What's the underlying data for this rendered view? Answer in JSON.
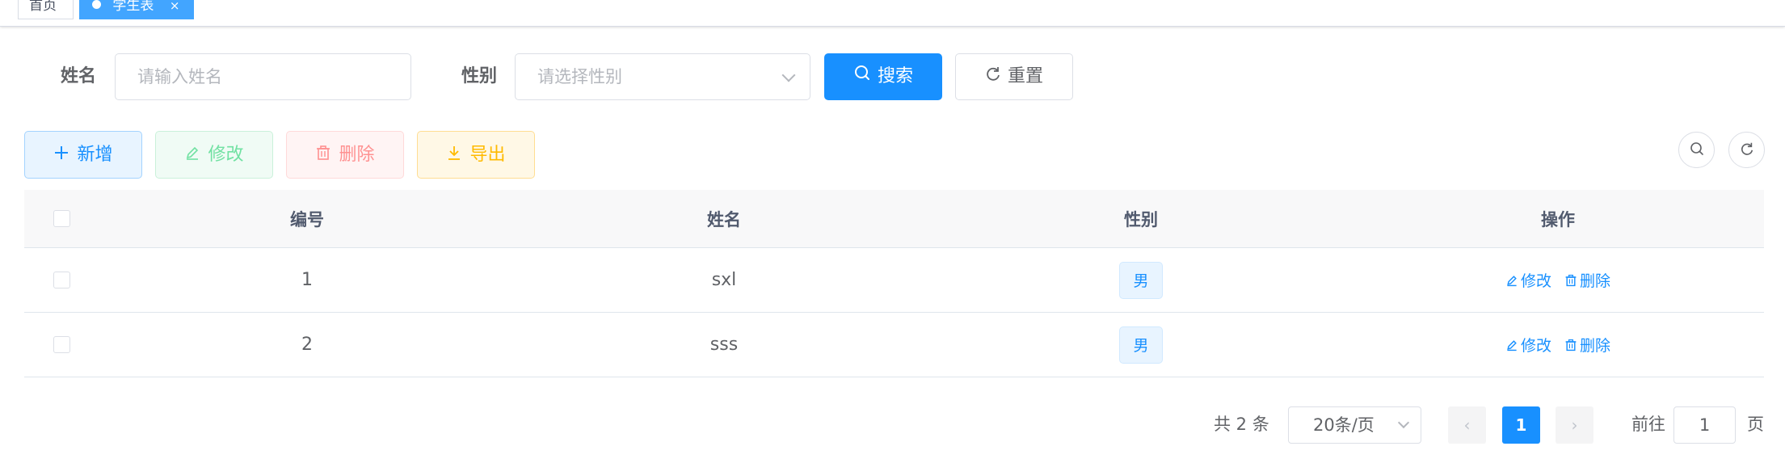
{
  "tags": {
    "home": "首页",
    "active": "学生表",
    "close_glyph": "×"
  },
  "search": {
    "name_label": "姓名",
    "name_placeholder": "请输入姓名",
    "sex_label": "性别",
    "sex_placeholder": "请选择性别",
    "search_button": "搜索",
    "reset_button": "重置"
  },
  "toolbar": {
    "add": "新增",
    "edit": "修改",
    "delete": "删除",
    "export": "导出"
  },
  "table": {
    "columns": [
      "编号",
      "姓名",
      "性别",
      "操作"
    ],
    "rows": [
      {
        "id": "1",
        "name": "sxl",
        "sex": "男",
        "edit": "修改",
        "delete": "删除"
      },
      {
        "id": "2",
        "name": "sss",
        "sex": "男",
        "edit": "修改",
        "delete": "删除"
      }
    ]
  },
  "pagination": {
    "total": "共 2 条",
    "page_size": "20条/页",
    "prev": "‹",
    "current": "1",
    "next": "›",
    "goto_label": "前往",
    "goto_value": "1",
    "page_suffix": "页"
  },
  "colors": {
    "primary": "#1890ff",
    "success": "#13ce66",
    "danger": "#ff4949",
    "warning": "#ffba00",
    "active_tag": "#42a5ff"
  },
  "icons": {
    "search": "search-icon",
    "reset": "refresh-icon",
    "add": "plus-icon",
    "edit": "edit-icon",
    "delete": "trash-icon",
    "export": "download-icon"
  }
}
